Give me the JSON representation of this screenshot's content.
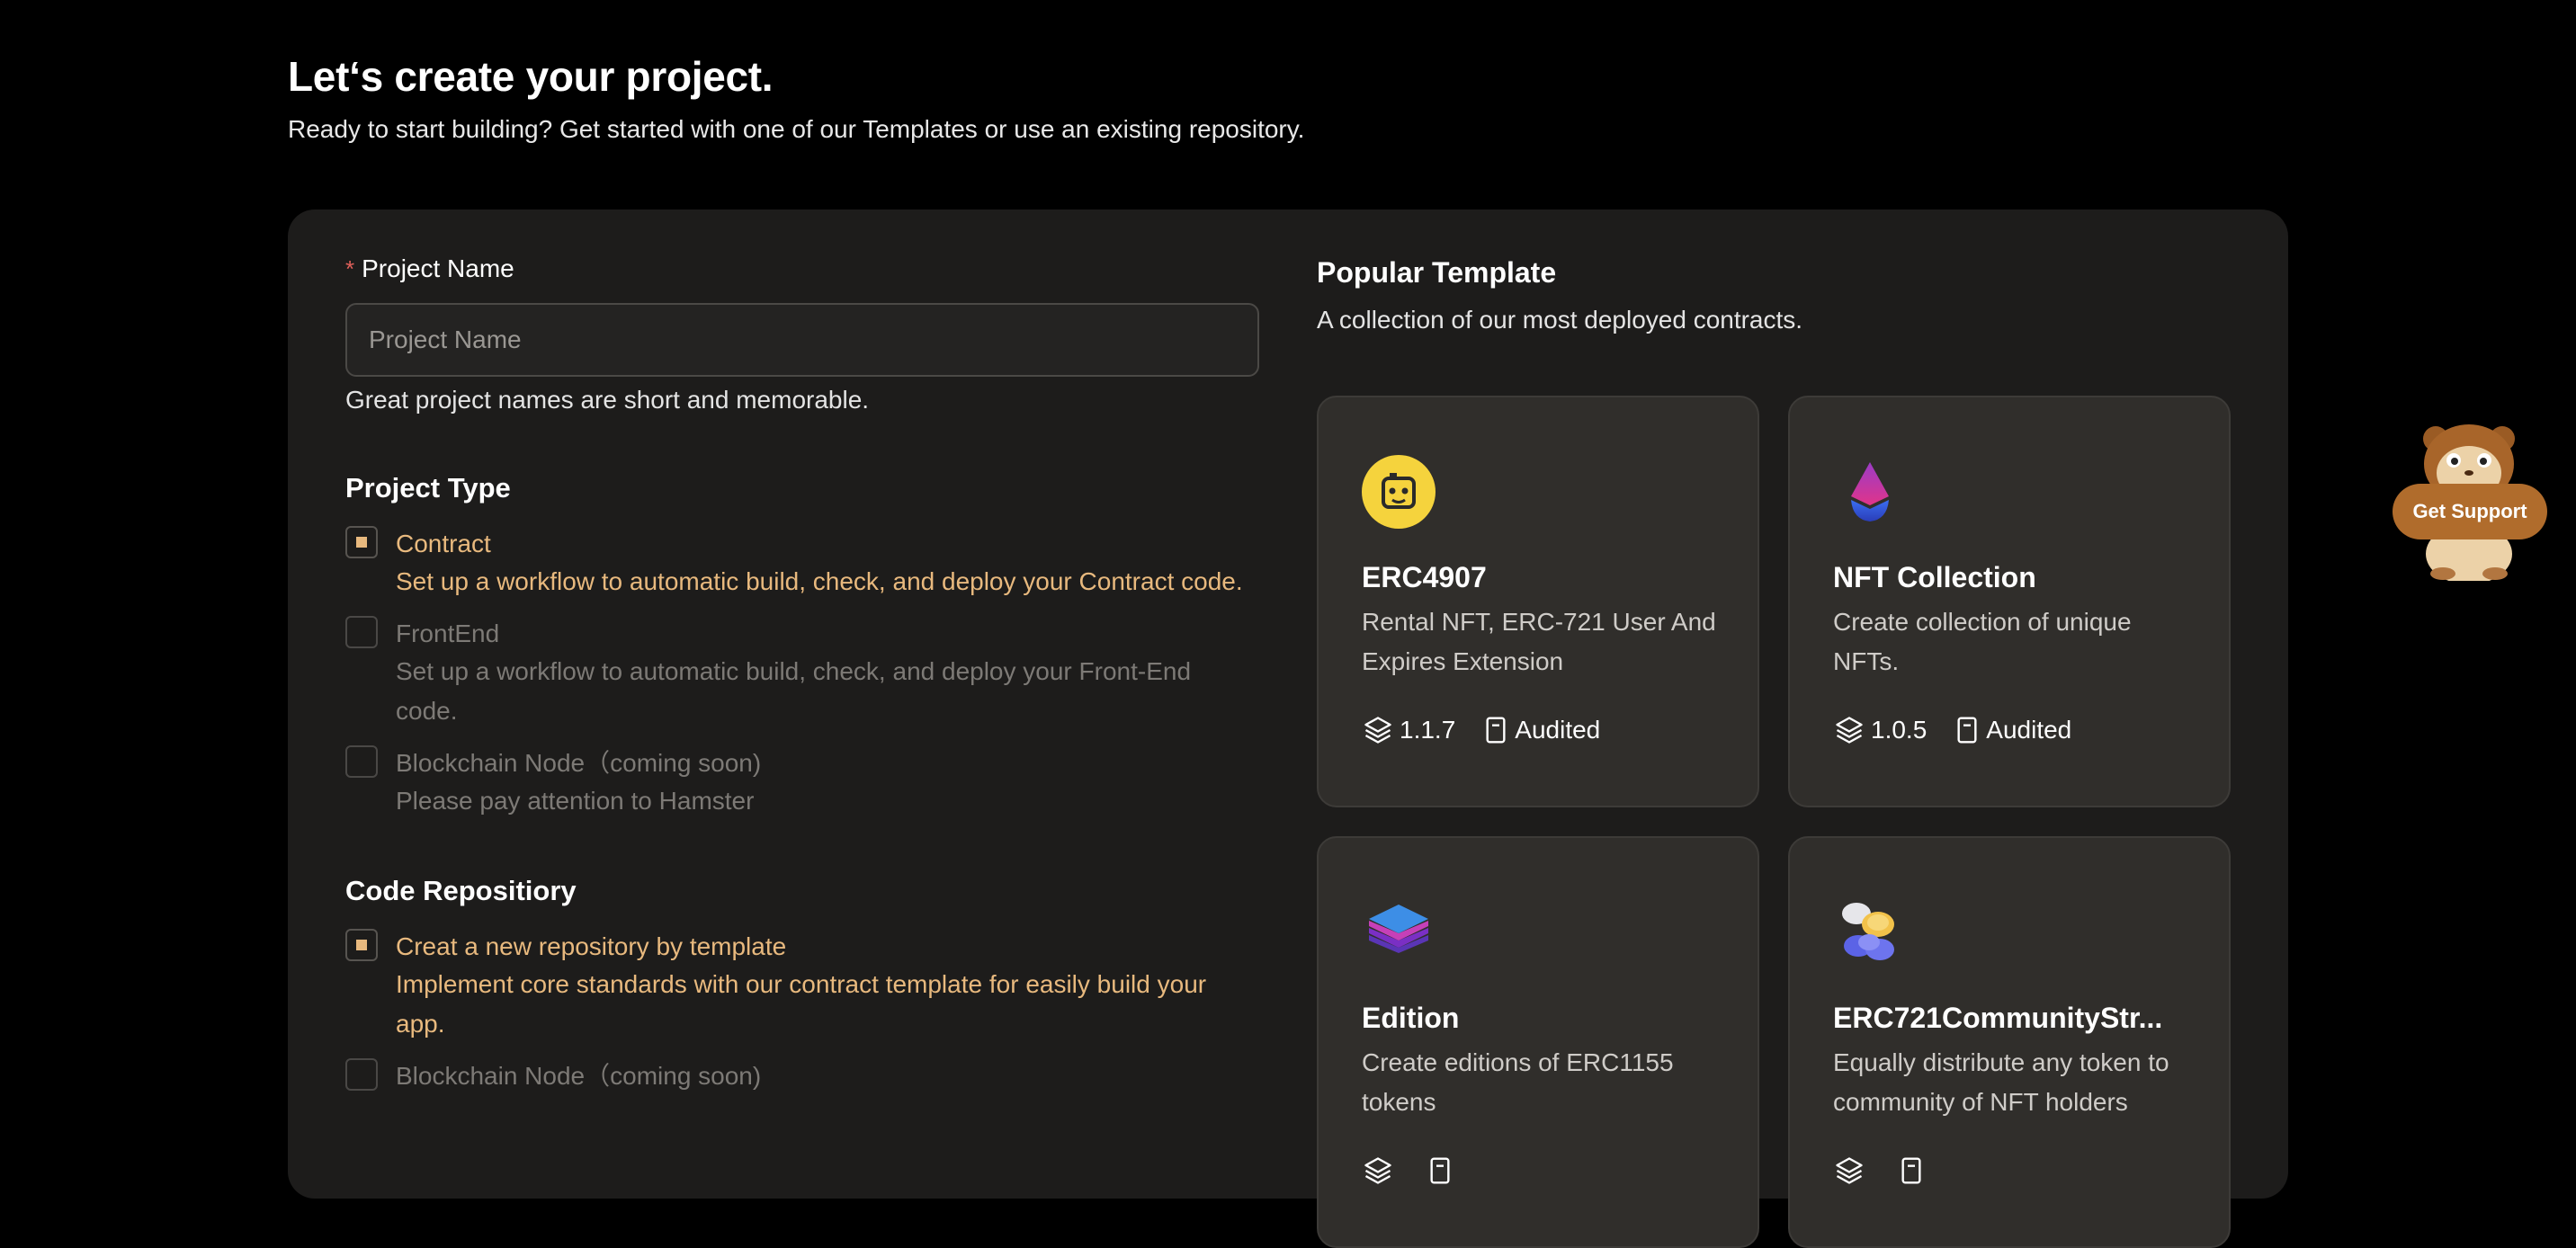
{
  "header": {
    "title": "Let‘s create your project.",
    "subtitle": "Ready to start building? Get started with one of our Templates or use an existing repository."
  },
  "form": {
    "project_name": {
      "required_mark": "*",
      "label": "Project Name",
      "placeholder": "Project Name",
      "value": "",
      "hint": "Great project names are short and memorable."
    },
    "project_type": {
      "title": "Project Type",
      "options": [
        {
          "title": "Contract",
          "desc": "Set up a workflow to automatic build, check, and deploy your Contract code.",
          "checked": true
        },
        {
          "title": "FrontEnd",
          "desc": "Set up a workflow to automatic build, check, and deploy your Front-End code.",
          "checked": false
        },
        {
          "title": "Blockchain Node（coming soon)",
          "desc": "Please pay attention to Hamster",
          "checked": false
        }
      ]
    },
    "code_repository": {
      "title": "Code Repositiory",
      "options": [
        {
          "title": "Creat a new repository by template",
          "desc": "Implement core standards with our contract template for easily build your app.",
          "checked": true
        },
        {
          "title": "Blockchain Node（coming soon)",
          "desc": "",
          "checked": false
        }
      ]
    }
  },
  "templates": {
    "title": "Popular Template",
    "subtitle": "A collection of our most deployed contracts.",
    "cards": [
      {
        "name": "ERC4907",
        "desc": "Rental NFT, ERC-721 User And Expires Extension",
        "version": "1.1.7",
        "status": "Audited",
        "icon": "robot-face-icon"
      },
      {
        "name": "NFT Collection",
        "desc": "Create collection of unique NFTs.",
        "version": "1.0.5",
        "status": "Audited",
        "icon": "ethereum-drop-icon"
      },
      {
        "name": "Edition",
        "desc": "Create editions of ERC1155 tokens",
        "version": "",
        "status": "",
        "icon": "stacked-layers-icon"
      },
      {
        "name": "ERC721CommunityStr...",
        "desc": "Equally distribute any token to community of NFT holders",
        "version": "",
        "status": "",
        "icon": "coins-icon"
      }
    ]
  },
  "support": {
    "label": "Get Support",
    "icon": "hamster-mascot-icon"
  },
  "colors": {
    "background": "#000000",
    "panel": "#1d1c1b",
    "card": "#302e2b",
    "accent": "#e8b97e",
    "required": "#e0605a",
    "support_button": "#b06c2c"
  }
}
